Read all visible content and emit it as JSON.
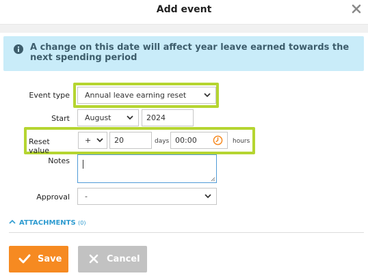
{
  "dialog": {
    "title": "Add event",
    "close_icon": "close-icon"
  },
  "info": {
    "icon": "info-icon",
    "message": "A change on this date will affect year leave earned towards the next spending period"
  },
  "form": {
    "event_type": {
      "label": "Event type",
      "value": "Annual leave earning reset"
    },
    "start": {
      "label": "Start",
      "month": "August",
      "year": "2024"
    },
    "reset_value": {
      "label": "Reset value",
      "sign": "+",
      "days": "20",
      "days_unit": "days",
      "time": "00:00",
      "hours_unit": "hours"
    },
    "notes": {
      "label": "Notes",
      "value": ""
    },
    "approval": {
      "label": "Approval",
      "value": "-"
    }
  },
  "attachments": {
    "label": "ATTACHMENTS",
    "count": "(0)"
  },
  "buttons": {
    "save": "Save",
    "cancel": "Cancel"
  },
  "colors": {
    "highlight": "#b5d531",
    "info_bg": "#c9ecf9",
    "save": "#f68a21",
    "cancel": "#c2c2c2",
    "link": "#2e9bd0"
  }
}
